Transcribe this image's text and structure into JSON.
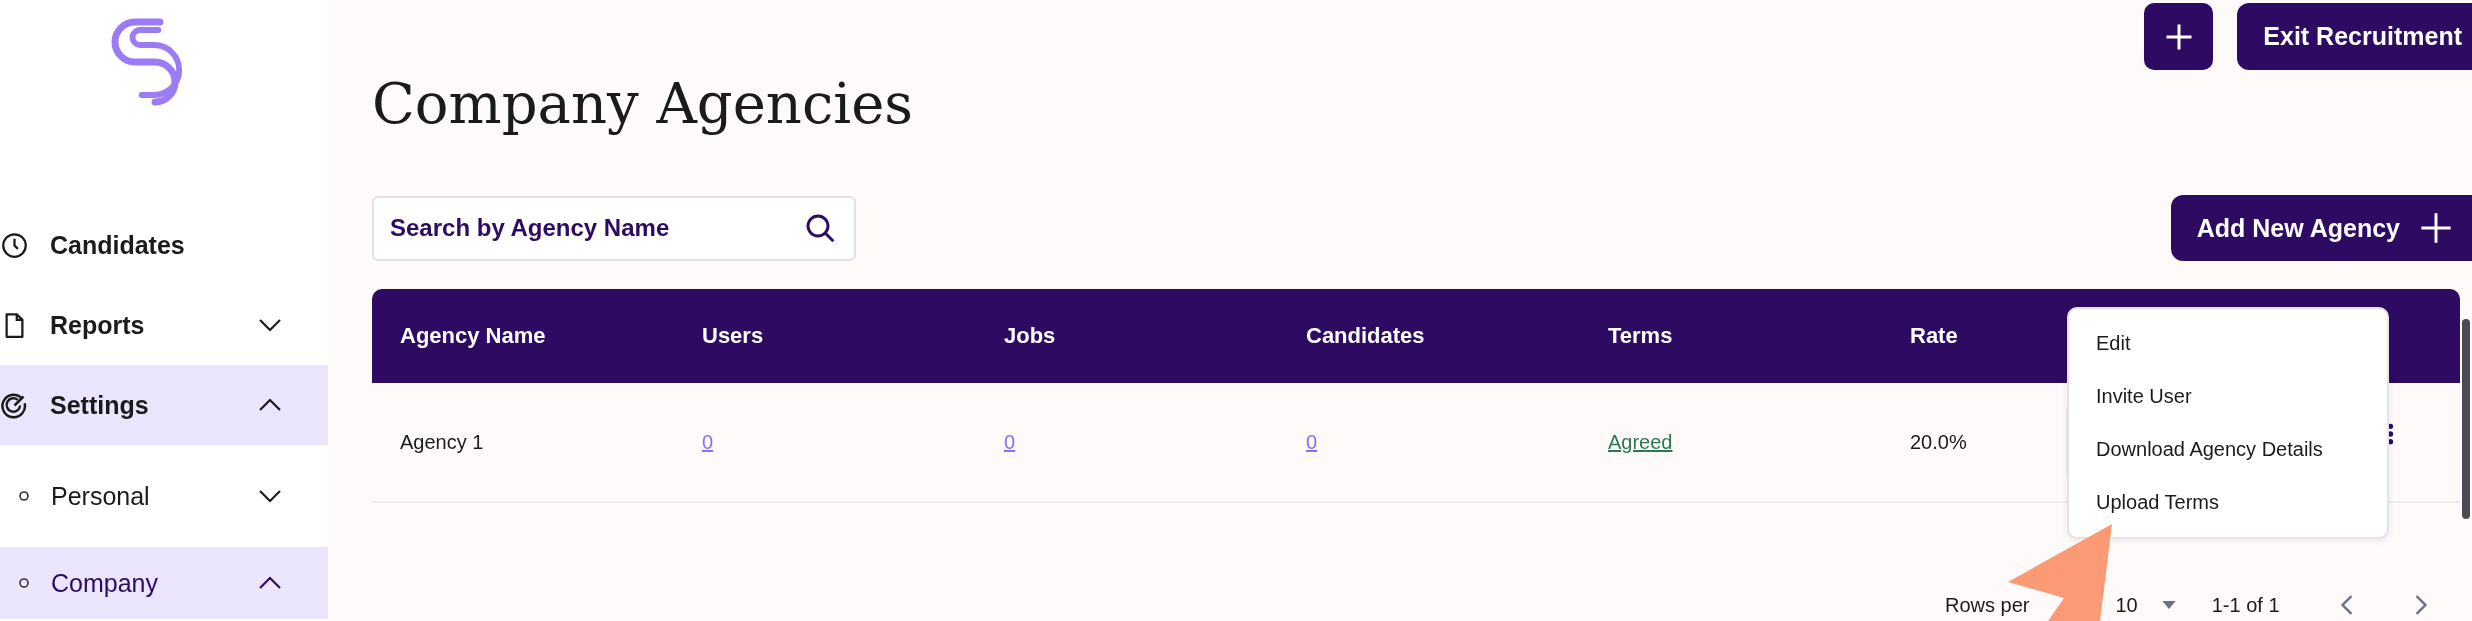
{
  "sidebar": {
    "items": [
      {
        "label": "Candidates",
        "kind": "top",
        "selected": false
      },
      {
        "label": "Reports",
        "kind": "top",
        "selected": false,
        "expanded": false
      },
      {
        "label": "Settings",
        "kind": "top",
        "selected": true,
        "expanded": true
      },
      {
        "label": "Personal",
        "kind": "sub",
        "selected": false,
        "expanded": false
      },
      {
        "label": "Company",
        "kind": "sub",
        "selected": true,
        "expanded": true
      }
    ]
  },
  "header": {
    "exit_button": "Exit Recruitment"
  },
  "page": {
    "title": "Company Agencies"
  },
  "search": {
    "placeholder": "Search by Agency Name"
  },
  "add_button": "Add New Agency",
  "table": {
    "columns": [
      "Agency Name",
      "Users",
      "Jobs",
      "Candidates",
      "Terms",
      "Rate"
    ],
    "rows": [
      {
        "cells": [
          "Agency 1",
          "0",
          "0",
          "0",
          "Agreed",
          "20.0%"
        ]
      }
    ]
  },
  "menu": {
    "items": [
      "Edit",
      "Invite User",
      "Download Agency Details",
      "Upload Terms"
    ]
  },
  "pagination": {
    "rows_label": "Rows per",
    "rows_value": "10",
    "range": "1-1 of 1"
  }
}
